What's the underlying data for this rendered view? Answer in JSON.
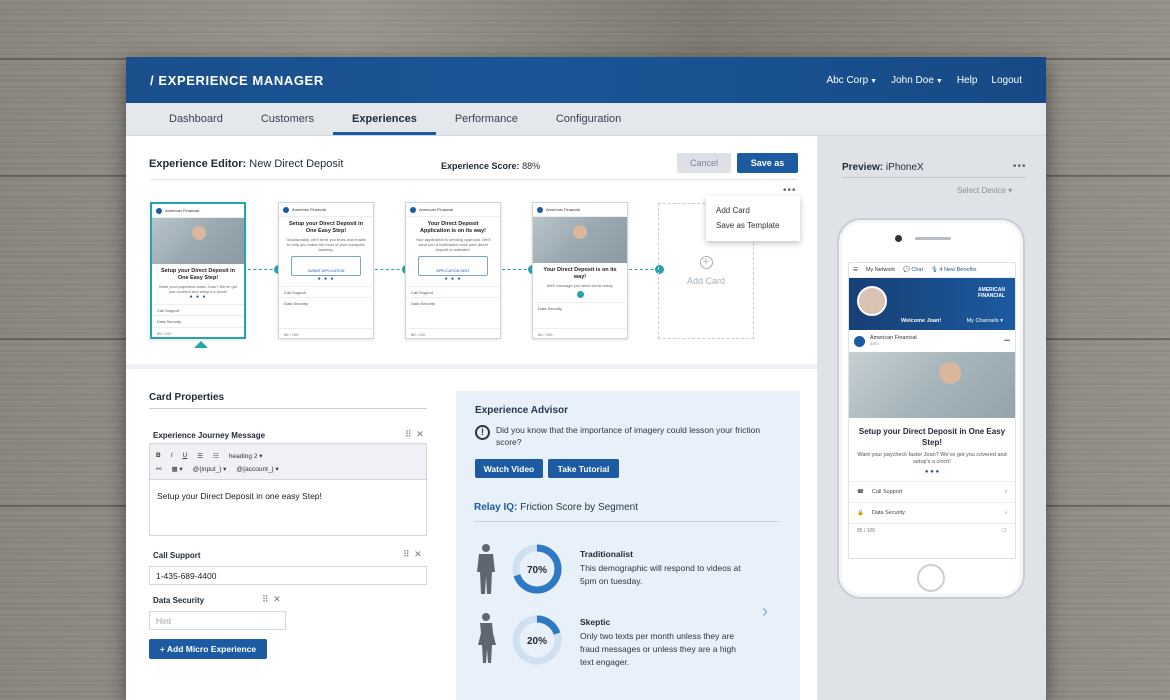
{
  "app": {
    "title": "/ EXPERIENCE MANAGER"
  },
  "topnav": {
    "company": "Abc Corp",
    "user": "John Doe",
    "help": "Help",
    "logout": "Logout"
  },
  "tabs": [
    {
      "label": "Dashboard"
    },
    {
      "label": "Customers"
    },
    {
      "label": "Experiences"
    },
    {
      "label": "Performance"
    },
    {
      "label": "Configuration"
    }
  ],
  "editor": {
    "label": "Experience Editor:",
    "name": "New Direct Deposit",
    "score_label": "Experience Score:",
    "score_value": "88%",
    "cancel": "Cancel",
    "save_as": "Save as",
    "more": "•••"
  },
  "cards": [
    {
      "brand": "American Financial",
      "title": "Setup your Direct Deposit in One Easy Step!",
      "sub": "Want your paycheck faster Joan? We've got you covered and setup's a cinch!",
      "row1": "Call Support",
      "row2": "Data Security",
      "foot": "85 / 100"
    },
    {
      "brand": "American Financial",
      "title": "Setup your Direct Deposit in One Easy Step!",
      "sub": "Occasionally, we'll send you texts and emails to help you make the most of your computer banking.",
      "upload": "SUBMIT APPLICATION",
      "row1": "Call Support",
      "row2": "Data Security",
      "foot": "85 / 100"
    },
    {
      "brand": "American Financial",
      "title": "Your Direct Deposit Application is on its way!",
      "sub": "Your application is pending approval. We'll send you a notification once your direct deposit is activated.",
      "upload": "APPLICATION SENT",
      "row1": "Call Support",
      "row2": "Data Security",
      "foot": "85 / 100"
    },
    {
      "brand": "American Financial",
      "title": "Your Direct Deposit is on its way!",
      "sub": "We'll message you when we're ready.",
      "row1": "Data Security",
      "foot": "85 / 100"
    }
  ],
  "add_card": {
    "label": "Add Card"
  },
  "menu": {
    "items": [
      "Add Card",
      "Save as Template"
    ]
  },
  "card_properties": {
    "title": "Card Properties",
    "journey_label": "Experience Journey Message",
    "toolbar_bold": "B",
    "toolbar_italic": "I",
    "toolbar_underline": "U",
    "toolbar_heading": "heading 2",
    "toolbar_input": "@{input_}",
    "toolbar_account": "@{account_}",
    "journey_text": "Setup your Direct Deposit in one easy Step!",
    "call_label": "Call Support",
    "call_value": "1-435-689-4400",
    "security_label": "Data Security",
    "security_placeholder": "Hint",
    "add_micro": "Add Micro Experience"
  },
  "advisor": {
    "title": "Experience Advisor",
    "tip": "Did you know that the importance of imagery could lesson your friction score?",
    "watch_video": "Watch Video",
    "take_tutorial": "Take Tutorial",
    "relay_prefix": "Relay IQ:",
    "relay_title": "Friction Score by Segment",
    "segments": [
      {
        "name": "Traditionalist",
        "desc": "This demographic will respond to videos at 5pm on tuesday.",
        "score": 0.7,
        "label": "70%"
      },
      {
        "name": "Skeptic",
        "desc": "Only two texts per month unless they are fraud messages or unless they are a high text engager.",
        "score": 0.2,
        "label": "20%"
      }
    ]
  },
  "preview": {
    "label": "Preview:",
    "device": "iPhoneX",
    "select_device": "Select Device",
    "nav_network": "My Network",
    "nav_chat": "Chat",
    "nav_benefits": "4 New Benefits",
    "brand_line1": "AMERICAN",
    "brand_line2": "FINANCIAL",
    "welcome": "Welcome Joan!",
    "channels": "My Channels",
    "post_brand": "American Financial",
    "post_time": "15m",
    "title": "Setup your Direct Deposit in One Easy Step!",
    "sub": "Want your paycheck faster Joan? We've got you covered and setup's a cinch!",
    "row1": "Call Support",
    "row2": "Data Security",
    "foot": "85 / 100"
  },
  "colors": {
    "primary": "#1c5aa1",
    "teal": "#27a3ab",
    "header": "#1a4f8c"
  }
}
